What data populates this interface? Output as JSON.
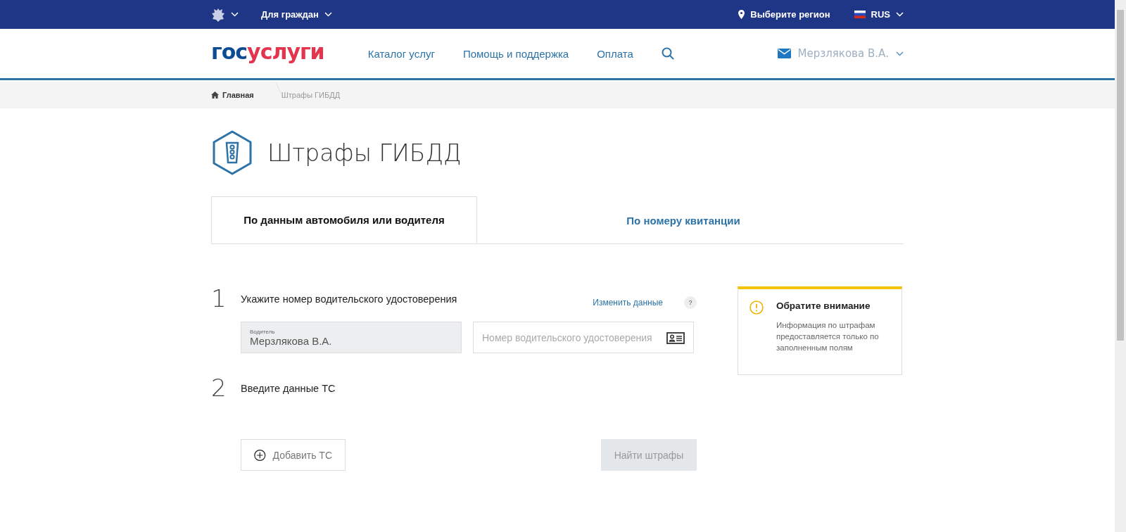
{
  "topbar": {
    "emblem_menu": true,
    "audience": "Для граждан",
    "region": "Выберите регион",
    "language": "RUS"
  },
  "header": {
    "logo": {
      "first": "гос",
      "second": "услуги"
    },
    "nav": [
      "Каталог услуг",
      "Помощь и поддержка",
      "Оплата"
    ],
    "user": "Мерзлякова В.А."
  },
  "breadcrumbs": [
    {
      "label": "Главная",
      "kind": "home"
    },
    {
      "label": "Штрафы ГИБДД",
      "kind": "current"
    }
  ],
  "page_title": "Штрафы ГИБДД",
  "tabs": [
    {
      "label": "По данным автомобиля или водителя",
      "selected": true
    },
    {
      "label": "По номеру квитанции",
      "selected": false
    }
  ],
  "steps": [
    {
      "number": "1",
      "title": "Укажите номер водительского удостоверения",
      "action": "Изменить данные",
      "help": "?",
      "fields": [
        {
          "label": "Водитель",
          "value": "Мерзлякова В.А.",
          "disabled": true
        },
        {
          "placeholder": "Номер водительского удостоверения",
          "disabled": false
        }
      ]
    },
    {
      "number": "2",
      "title": "Введите данные ТС"
    }
  ],
  "buttons": [
    {
      "label": "Добавить ТС",
      "kind": "add",
      "disabled": false
    },
    {
      "label": "Найти штрафы",
      "kind": "submit",
      "disabled": true
    }
  ],
  "notice": {
    "title": "Обратите внимание",
    "text": "Информация по штрафам предоставляется только по заполненным полям"
  }
}
